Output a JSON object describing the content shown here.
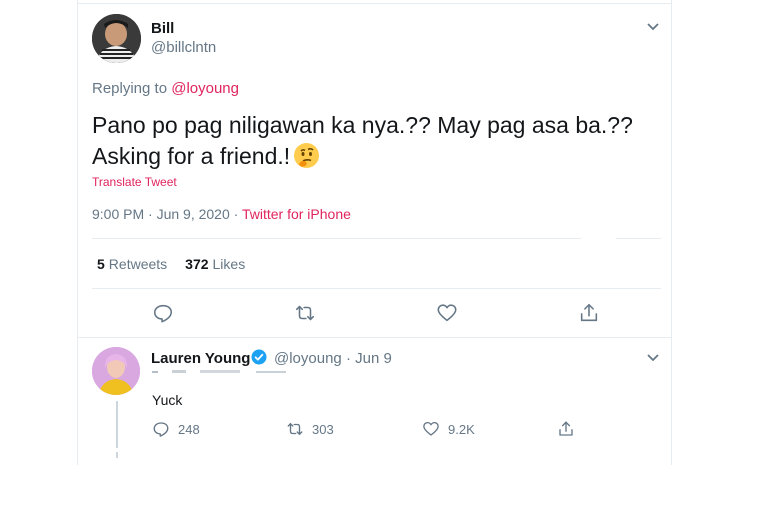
{
  "main_tweet": {
    "author_name": "Bill",
    "author_handle": "@billclntn",
    "replying_prefix": "Replying to",
    "replying_to": "@loyoung",
    "text_line1": "Pano po pag niligawan ka nya.?? May pag asa ba.??",
    "text_line2": "Asking for a friend.!",
    "emoji": "thinking-face",
    "translate_label": "Translate Tweet",
    "timestamp": "9:00 PM · Jun 9, 2020 · ",
    "source": "Twitter for iPhone",
    "retweets_count": "5",
    "retweets_label": "Retweets",
    "likes_count": "372",
    "likes_label": "Likes",
    "actions": [
      "reply-icon",
      "retweet-icon",
      "like-icon",
      "share-icon"
    ]
  },
  "reply_tweet": {
    "author_name": "Lauren Young",
    "verified": true,
    "author_handle": "@loyoung",
    "separator": "·",
    "date": "Jun 9",
    "text": "Yuck",
    "reply_count": "248",
    "retweet_count": "303",
    "like_count": "9.2K"
  },
  "colors": {
    "accent": "#e0245e",
    "secondary_text": "#657786",
    "border": "#e6ecf0",
    "verified": "#1da1f2"
  }
}
